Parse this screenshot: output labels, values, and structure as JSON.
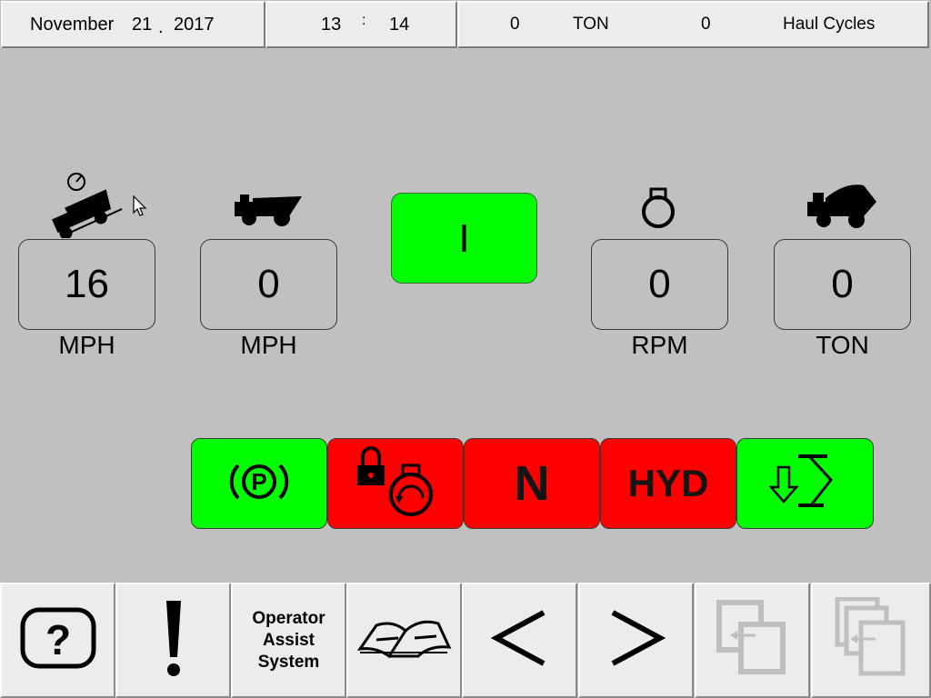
{
  "header": {
    "month": "November",
    "day": "21",
    "date_sep": ".",
    "year": "2017",
    "hour": "13",
    "time_sep": ":",
    "minute": "14",
    "tons_value": "0",
    "tons_unit": "TON",
    "haul_count": "0",
    "haul_label": "Haul Cycles"
  },
  "gauges": [
    {
      "icon": "truck-downhill-speed-icon",
      "value": "16",
      "unit": "MPH"
    },
    {
      "icon": "truck-speed-icon",
      "value": "0",
      "unit": "MPH"
    },
    {
      "icon": "engine-icon",
      "value": "0",
      "unit": "RPM"
    },
    {
      "icon": "loaded-truck-icon",
      "value": "0",
      "unit": "TON"
    }
  ],
  "gear": {
    "label": "I",
    "color": "#00ff00"
  },
  "indicators": [
    {
      "icon": "parking-brake-icon",
      "color": "#00ff00"
    },
    {
      "icon": "engine-lock-icon",
      "color": "#ff0000"
    },
    {
      "label": "N",
      "color": "#ff0000"
    },
    {
      "label": "HYD",
      "color": "#ff0000"
    },
    {
      "icon": "body-down-icon",
      "color": "#00ff00"
    }
  ],
  "bottom": {
    "help_icon": "help-icon",
    "alert_icon": "alert-icon",
    "operator_assist_label": "Operator\nAssist\nSystem",
    "manual_icon": "manual-icon",
    "prev_icon": "chevron-left-icon",
    "next_icon": "chevron-right-icon",
    "window_single_icon": "window-icon",
    "window_multi_icon": "windows-stack-icon"
  }
}
